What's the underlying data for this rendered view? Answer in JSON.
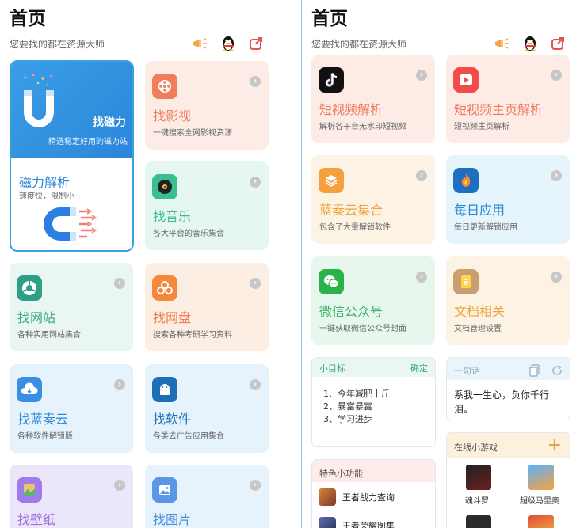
{
  "left": {
    "title": "首页",
    "subtitle": "您要找的都在资源大师",
    "magnet": {
      "top_title": "找磁力",
      "top_desc": "精选稳定好用的磁力站",
      "title": "磁力解析",
      "desc": "速度快，限制小"
    },
    "cards": [
      {
        "title": "找影视",
        "desc": "一键搜索全网影视资源",
        "icon": "film-reel-icon",
        "bg": "#fdece6",
        "accent": "#f07a5e"
      },
      {
        "title": "找音乐",
        "desc": "各大平台的音乐集合",
        "icon": "vinyl-record-icon",
        "bg": "#e6f7f1",
        "accent": "#3cbf8e"
      },
      {
        "title": "找网站",
        "desc": "各种实用网站集合",
        "icon": "chrome-icon",
        "bg": "#e9f6f2",
        "accent": "#3aa68a"
      },
      {
        "title": "找网盘",
        "desc": "搜索各种考研学习资料",
        "icon": "network-share-icon",
        "bg": "#fdeee4",
        "accent": "#f07b4c"
      },
      {
        "title": "找蓝奏云",
        "desc": "各种软件解锁版",
        "icon": "cloud-icon",
        "bg": "#e6f2fc",
        "accent": "#2c87d9"
      },
      {
        "title": "找软件",
        "desc": "各类去广告应用集合",
        "icon": "android-icon",
        "bg": "#e6f2fc",
        "accent": "#1b6db5"
      },
      {
        "title": "找壁纸",
        "desc": "",
        "icon": "wallpaper-icon",
        "bg": "#ece6fb",
        "accent": "#9b6ee8"
      },
      {
        "title": "找图片",
        "desc": "",
        "icon": "picture-icon",
        "bg": "#e6f2fc",
        "accent": "#4a8fe0"
      }
    ]
  },
  "right": {
    "title": "首页",
    "subtitle": "您要找的都在资源大师",
    "cards": [
      {
        "title": "短视频解析",
        "desc": "解析各平台无水印短视频",
        "icon": "tiktok-icon",
        "bg": "#fdece6",
        "accent": "#f07a5e"
      },
      {
        "title": "短视频主页解析",
        "desc": "短视频主页解析",
        "icon": "play-button-icon",
        "bg": "#fdece6",
        "accent": "#f07a5e"
      },
      {
        "title": "蓝奏云集合",
        "desc": "包含了大量解锁软件",
        "icon": "layers-icon",
        "bg": "#fdf3e4",
        "accent": "#f0a13c"
      },
      {
        "title": "每日应用",
        "desc": "每日更新解锁应用",
        "icon": "flame-icon",
        "bg": "#e6f4fc",
        "accent": "#2386d4"
      },
      {
        "title": "微信公众号",
        "desc": "一键获取微信公众号封面",
        "icon": "wechat-icon",
        "bg": "#e8f7ee",
        "accent": "#3cb56a"
      },
      {
        "title": "文档相关",
        "desc": "文档管理设置",
        "icon": "document-icon",
        "bg": "#fdf3e4",
        "accent": "#f0a13c"
      }
    ],
    "goals": {
      "title": "小目标",
      "confirm": "确定",
      "items": [
        "1、今年减肥十斤",
        "2、暴富暴富",
        "3、学习进步"
      ]
    },
    "quote": {
      "title": "一句话",
      "text": "系我一生心，负你千行泪。"
    },
    "features": {
      "title": "特色小功能",
      "items": [
        "王者战力查询",
        "王者荣耀图集"
      ]
    },
    "games": {
      "title": "在线小游戏",
      "add": "+",
      "items": [
        "魂斗罗",
        "超级马里奥"
      ]
    }
  }
}
